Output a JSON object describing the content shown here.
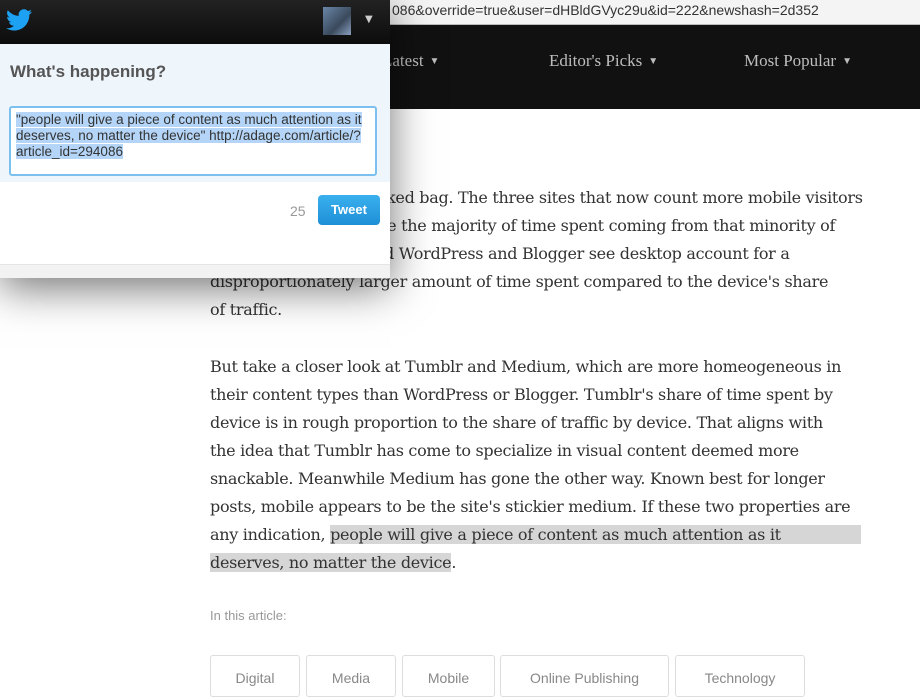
{
  "browser": {
    "url_fragment": "086&override=true&user=dHBldGVyc29u&id=222&newshash=2d352"
  },
  "nav": {
    "items": [
      {
        "label": "Latest"
      },
      {
        "label": "Editor's Picks"
      },
      {
        "label": "Most Popular"
      }
    ],
    "caret": "▼"
  },
  "article": {
    "para1": [
      "ked bag. The three sites that now count more mobile visitors",
      "ee the majority of time spent coming from that minority of",
      "d WordPress and Blogger see desktop account for a",
      "disproportionately larger amount of time spent compared to the device's share",
      "of traffic."
    ],
    "para2": [
      "But take a closer look at Tumblr and Medium, which are more homeogeneous in",
      "their content types than WordPress or Blogger. Tumblr's share of time spent by",
      "device is in rough proportion to the share of traffic by device. That aligns with",
      "the idea that Tumblr has come to specialize in visual content deemed more",
      "snackable. Meanwhile Medium has gone the other way. Known best for longer",
      "posts, mobile appears to be the site's stickier medium. If these two properties are"
    ],
    "para2_line7_prefix": "any indication, ",
    "highlight_1": "people will give a piece of content as much attention as it",
    "highlight_2": "deserves, no matter the device",
    "highlight_end": ".",
    "in_this_article": "In this article:",
    "tags": [
      "Digital",
      "Media",
      "Mobile",
      "Online Publishing",
      "Technology"
    ]
  },
  "twitter_popup": {
    "title": "What's happening?",
    "tweet_text": "\"people will give a piece of content as much attention as it deserves, no matter the device\" http://adage.com/article/?article_id=294086",
    "char_count": "25",
    "tweet_button": "Tweet",
    "caret": "▼"
  },
  "colors": {
    "twitter_blue": "#1da1f2",
    "tweet_button": "#2a9fe4",
    "nav_bg": "#111111",
    "highlight": "#d6d6d6"
  }
}
